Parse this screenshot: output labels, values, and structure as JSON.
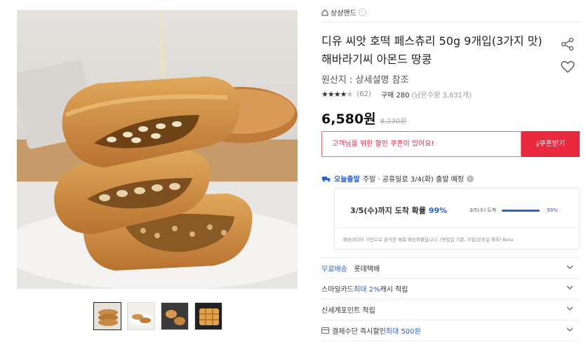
{
  "gallery": {
    "thumbnails": [
      {
        "icon": "pastry-stack-thumbnail"
      },
      {
        "icon": "pastry-plate-thumbnail"
      },
      {
        "icon": "pastry-pan-thumbnail"
      },
      {
        "icon": "waffle-pan-thumbnail"
      }
    ]
  },
  "product": {
    "brand": "상상앤드",
    "title": "디유 씨앗 호떡 페스츄리 50g 9개입(3가지 맛) 해바라기씨 아몬드 땅콩",
    "origin": "원산지 : 상세설명 참조",
    "rating_stars": "★★★★",
    "rating_half": "★",
    "rating_count": "(62)",
    "purchases": "구매 280",
    "stock": "(남은수량 3,631개)",
    "price": "6,580원",
    "original_price": "8,230원",
    "rating_value": 4.5
  },
  "coupon": {
    "message": "고객님을 위한 할인 쿠폰이 있어요!",
    "button": "⤓쿠폰받기"
  },
  "shipping": {
    "today_label": "오늘출발",
    "today_text": "주말 · 공휴일로 3/4(화) 출발 예정",
    "info_icon": "i",
    "arrival_text": "3/5(수)까지 도착 확률 ",
    "arrival_pct": "99%",
    "mini_label": "3/5(수) 도착",
    "mini_pct": "99%",
    "mini_value": 0.99,
    "note": "배송데이터 기반으로 분석한 예측 배송확률입니다. (영업일 기준, 주말/공휴일 제외) Beta"
  },
  "options": {
    "delivery_label": "무료배송",
    "delivery_carrier": "롯데택배",
    "smilecard_prefix": "스마일카드 ",
    "smilecard_max": "최대 2%",
    "smilecard_suffix": " 캐시 적립",
    "points": "신세계포인트 적립",
    "payment_prefix": "결제수단 즉시할인 ",
    "payment_max": "최대 500원"
  },
  "colors": {
    "accent_red": "#e8293f",
    "accent_blue": "#2b62d9"
  }
}
